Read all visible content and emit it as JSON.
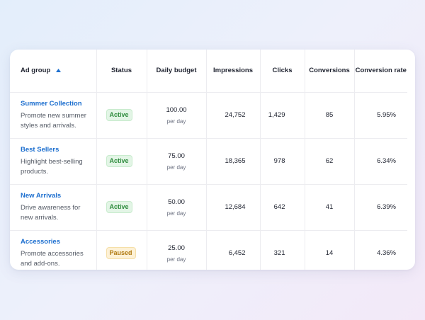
{
  "table": {
    "columns": {
      "ad_group": "Ad group",
      "status": "Status",
      "daily_budget": "Daily budget",
      "impressions": "Impressions",
      "clicks": "Clicks",
      "conversions": "Conversions",
      "conversion_rate": "Conversion rate"
    },
    "sort": {
      "column": "Ad group",
      "direction": "ascending",
      "icon": "triangle-up-icon"
    },
    "rows": [
      {
        "name": "Summer Collection",
        "description": "Promote new summer styles and arrivals.",
        "status": "Active",
        "budget": "100.00",
        "budget_unit": "per day",
        "impressions": "24,752",
        "clicks": "1,429",
        "conversions": "85",
        "conversion_rate": "5.95%"
      },
      {
        "name": "Best Sellers",
        "description": "Highlight best-selling products.",
        "status": "Active",
        "budget": "75.00",
        "budget_unit": "per day",
        "impressions": "18,365",
        "clicks": "978",
        "conversions": "62",
        "conversion_rate": "6.34%"
      },
      {
        "name": "New Arrivals",
        "description": "Drive awareness for new arrivals.",
        "status": "Active",
        "budget": "50.00",
        "budget_unit": "per day",
        "impressions": "12,684",
        "clicks": "642",
        "conversions": "41",
        "conversion_rate": "6.39%"
      },
      {
        "name": "Accessories",
        "description": "Promote accessories and add-ons.",
        "status": "Paused",
        "budget": "25.00",
        "budget_unit": "per day",
        "impressions": "6,452",
        "clicks": "321",
        "conversions": "14",
        "conversion_rate": "4.36%"
      }
    ]
  },
  "colors": {
    "link": "#1d6fcf",
    "active_badge_bg": "#e3f5e6",
    "active_badge_text": "#2e8b3d",
    "paused_badge_bg": "#fdf1d6",
    "paused_badge_text": "#b07a12"
  }
}
